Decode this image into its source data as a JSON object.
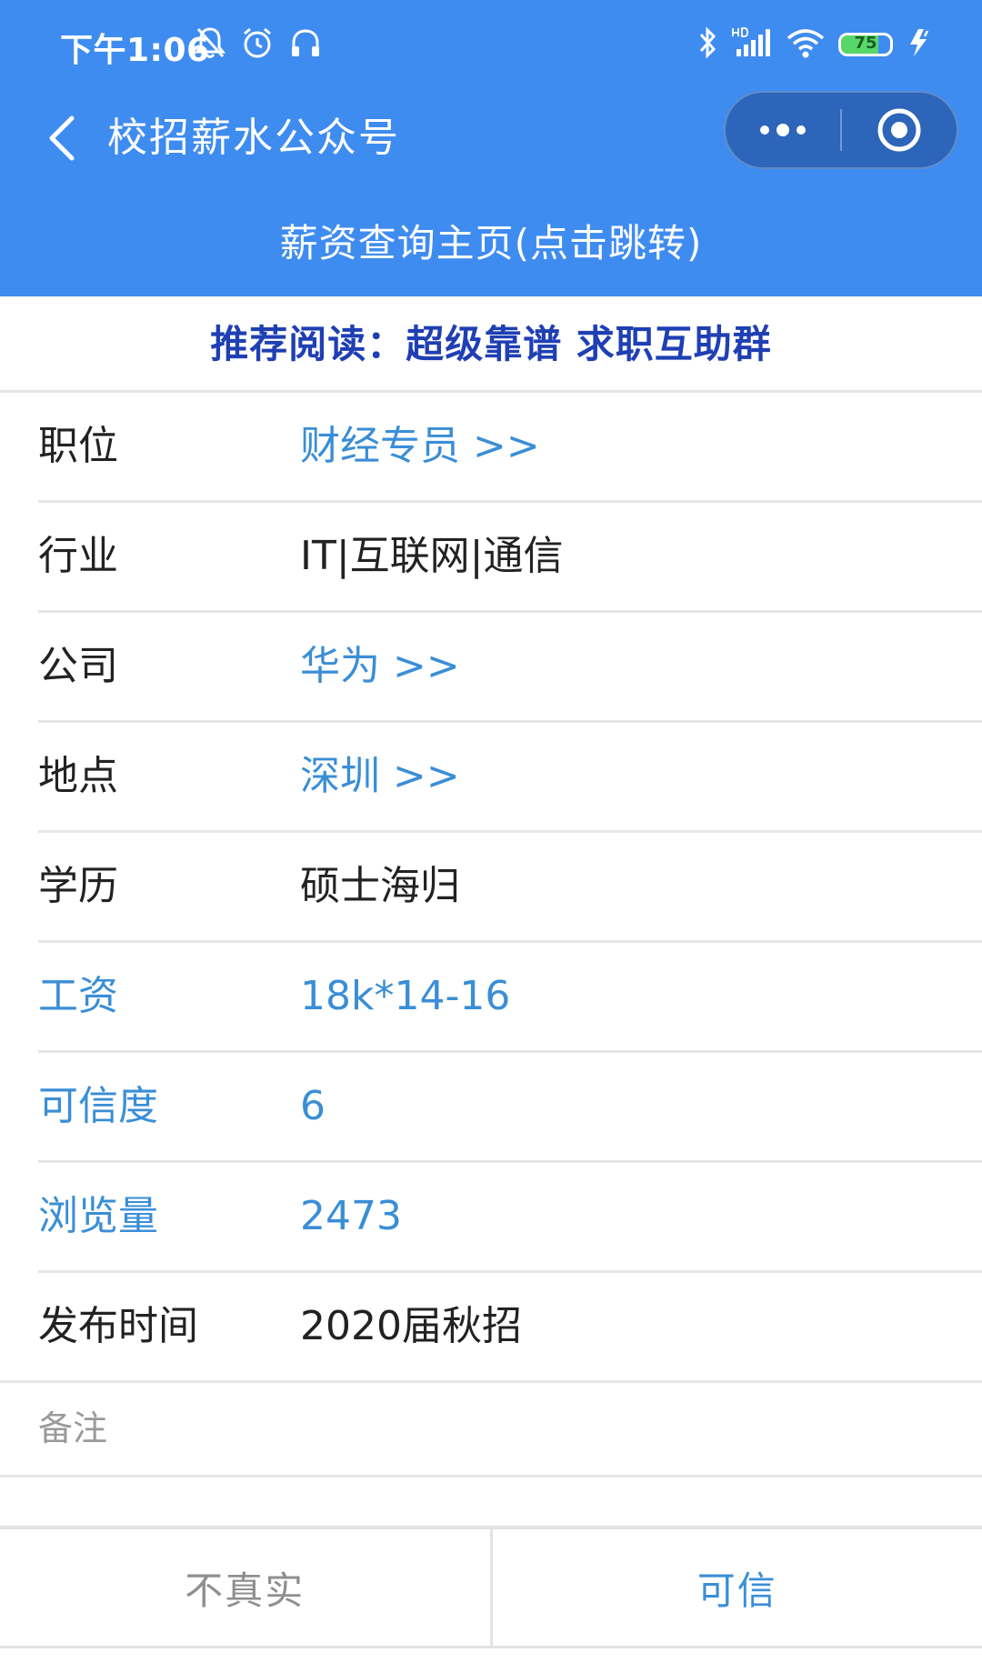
{
  "status_bar": {
    "time": "下午1:06",
    "battery": "75"
  },
  "nav": {
    "title": "校招薪水公众号"
  },
  "home_link": "薪资查询主页(点击跳转)",
  "recommend": "推荐阅读：超级靠谱 求职互助群",
  "rows": [
    {
      "label": "职位",
      "value": "财经专员 >>"
    },
    {
      "label": "行业",
      "value": "IT|互联网|通信"
    },
    {
      "label": "公司",
      "value": "华为 >>"
    },
    {
      "label": "地点",
      "value": "深圳 >>"
    },
    {
      "label": "学历",
      "value": "硕士海归"
    },
    {
      "label": "工资",
      "value": "18k*14-16"
    },
    {
      "label": "可信度",
      "value": "6"
    },
    {
      "label": "浏览量",
      "value": "2473"
    },
    {
      "label": "发布时间",
      "value": "2020届秋招"
    }
  ],
  "remark": {
    "label": "备注"
  },
  "actions": {
    "fake_label": "不真实",
    "trust_label": "可信"
  },
  "colors": {
    "header": "#3f8cf0",
    "link": "#3a8ed6",
    "recommend": "#1f3fb3"
  }
}
